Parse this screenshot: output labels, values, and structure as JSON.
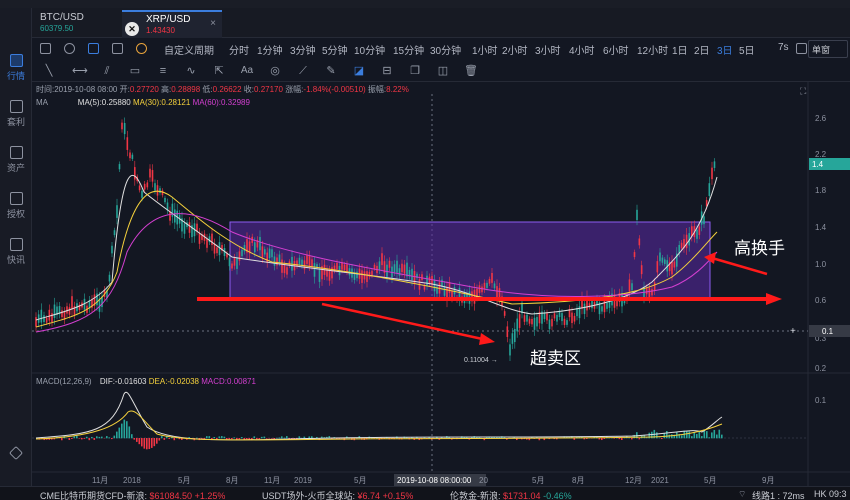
{
  "sidebar": {
    "items": [
      {
        "label": "行情",
        "icon": "chart-icon",
        "active": true
      },
      {
        "label": "套利",
        "icon": "arbitrage-icon",
        "active": false
      },
      {
        "label": "资产",
        "icon": "wallet-icon",
        "active": false
      },
      {
        "label": "授权",
        "icon": "key-icon",
        "active": false
      },
      {
        "label": "快讯",
        "icon": "news-icon",
        "active": false
      },
      {
        "label": "",
        "icon": "diamond-icon",
        "active": false
      }
    ]
  },
  "tabs": [
    {
      "name": "BTC/USD",
      "sub": "60379.50"
    },
    {
      "name": "XRP/USD",
      "sub": "1.43430"
    }
  ],
  "toolbar": {
    "custom_period": "自定义周期",
    "intervals": [
      "分时",
      "1分钟",
      "3分钟",
      "5分钟",
      "10分钟",
      "15分钟",
      "30分钟",
      "1小时",
      "2小时",
      "3小时",
      "4小时",
      "6小时",
      "12小时",
      "1日",
      "2日",
      "3日",
      "5日"
    ],
    "active_interval": "3日",
    "extra": "7s",
    "right_button": "单窗"
  },
  "ohlc": {
    "time": "时间:2019-10-08 08:00",
    "open_label": "开:",
    "open": "0.27720",
    "high_label": "高:",
    "high": "0.28898",
    "low_label": "低:",
    "low": "0.26622",
    "close_label": "收:",
    "close": "0.27170",
    "change_label": "涨幅:",
    "change": "-1.84%(-0.00510)",
    "amp_label": "振幅:",
    "amp": "8.22%"
  },
  "ma": {
    "name": "MA",
    "ma5": "MA(5):0.25880",
    "ma30": "MA(30):0.28121",
    "ma60": "MA(60):0.32989",
    "colors": {
      "ma5": "#e0e0e0",
      "ma30": "#f5d13c",
      "ma60": "#d33fd0"
    }
  },
  "macd": {
    "name": "MACD(12,26,9)",
    "dif": "DIF:-0.01603",
    "dea": "DEA:-0.02038",
    "macd": "MACD:0.00871"
  },
  "annotations": {
    "high_turnover": "高换手",
    "oversold": "超卖区",
    "low_price": "0.11004"
  },
  "axis": {
    "price_ticks": [
      "2.6",
      "2.2",
      "1.8",
      "1.4",
      "1.0",
      "0.6",
      "0.3",
      "0.2",
      "0.1"
    ],
    "current_price": "1.4",
    "crosshair_price": "0.1",
    "time_ticks": [
      "11月",
      "2018",
      "5月",
      "8月",
      "11月",
      "2019",
      "5月",
      "2019-10-08 08:00:00",
      "20",
      "5月",
      "8月",
      "12月",
      "2021",
      "5月",
      "9月"
    ]
  },
  "status": {
    "s1_label": "CME比特币期货CFD-新浪:",
    "s1_val": "$61084.50",
    "s1_chg": "+1.25%",
    "s2_label": "USDT场外-火币全球站:",
    "s2_val": "¥6.74",
    "s2_chg": "+0.15%",
    "s3_label": "伦敦金-新浪:",
    "s3_val": "$1731.04",
    "s3_chg": "-0.46%",
    "line": "线路1 : 72ms",
    "time": "HK 09:3"
  },
  "colors": {
    "up": "#26a69a",
    "down": "#f23645",
    "accent": "#3b7ddd",
    "zone": "#7b3fd1"
  }
}
